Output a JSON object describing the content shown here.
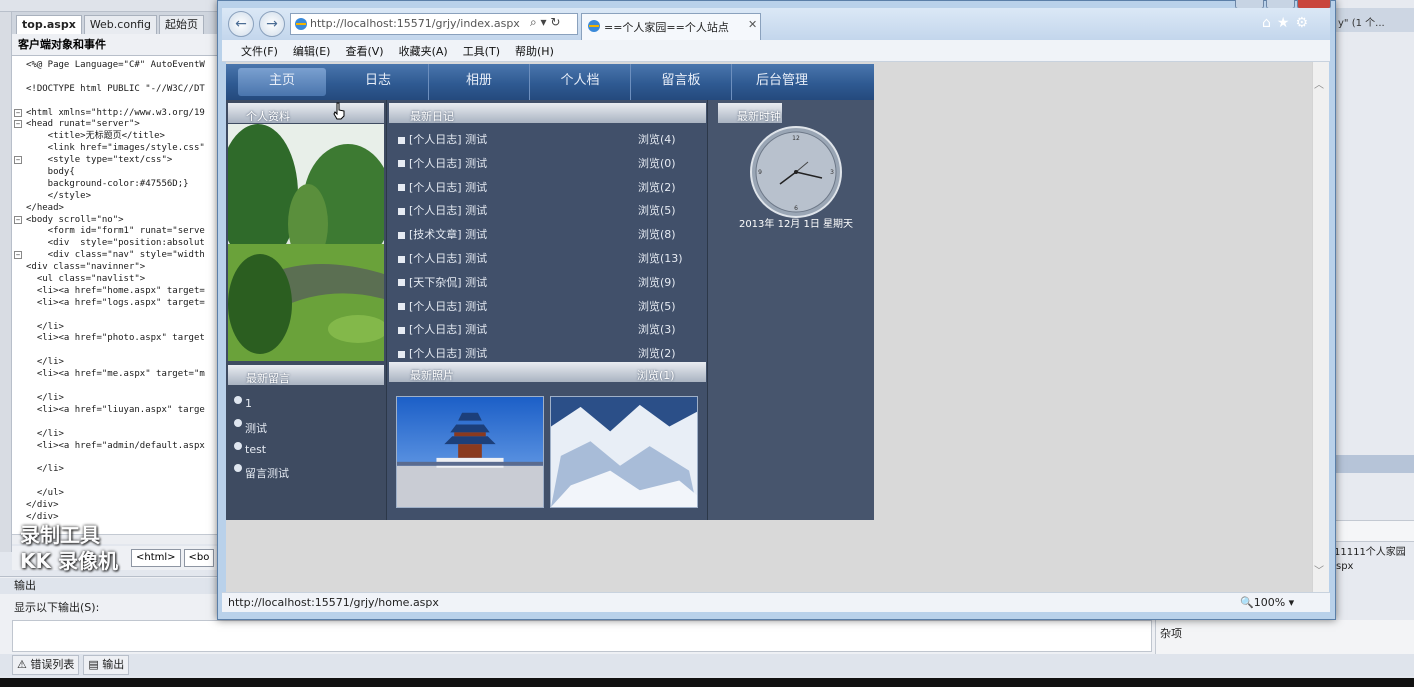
{
  "ide": {
    "tabs": [
      "top.aspx",
      "Web.config",
      "起始页"
    ],
    "object_bar": "客户端对象和事件",
    "code_lines": [
      "<%@ Page Language=\"C#\" AutoEventW",
      "",
      "<!DOCTYPE html PUBLIC \"-//W3C//DT",
      "",
      "<html xmlns=\"http://www.w3.org/19",
      "<head runat=\"server\">",
      "    <title>无标题页</title>",
      "    <link href=\"images/style.css\"",
      "    <style type=\"text/css\">",
      "    body{",
      "    background-color:#47556D;}",
      "    </style>",
      "</head>",
      "<body scroll=\"no\">",
      "    <form id=\"form1\" runat=\"serve",
      "    <div  style=\"position:absolut",
      "    <div class=\"nav\" style=\"width",
      "<div class=\"navinner\">",
      "  <ul class=\"navlist\">",
      "  <li><a href=\"home.aspx\" target=",
      "  <li><a href=\"logs.aspx\" target=",
      "",
      "  </li>",
      "  <li><a href=\"photo.aspx\" target",
      "",
      "  </li>",
      "  <li><a href=\"me.aspx\" target=\"m",
      "",
      "  </li>",
      "  <li><a href=\"liuyan.aspx\" targe",
      "",
      "  </li>",
      "  <li><a href=\"admin/default.aspx",
      "",
      "  </li>",
      "",
      "  </ul>",
      "</div>",
      "</div>"
    ],
    "breadcrumbs": [
      "<html>",
      "<bo"
    ],
    "watermark_line1": "录制工具",
    "watermark_line2": "KK 录像机",
    "output_title": "输出",
    "output_label": "显示以下输出(S):",
    "bottom_tabs": [
      "错误列表",
      "输出"
    ],
    "misc_label": "杂项",
    "right_text_top": "y\" (1 个...",
    "right_text_mid": "11111个人家园",
    "right_text_low": "spx"
  },
  "browser": {
    "address": "http://localhost:15571/grjy/index.aspx",
    "address_tools": "⌕ ▾ ↻",
    "tab_title": "==个人家园==个人站点",
    "tab_close": "✕",
    "menus": [
      "文件(F)",
      "编辑(E)",
      "查看(V)",
      "收藏夹(A)",
      "工具(T)",
      "帮助(H)"
    ],
    "status_url": "http://localhost:15571/grjy/home.aspx",
    "zoom": "🔍100%  ▾",
    "right_icons": "⌂★⚙"
  },
  "site": {
    "nav": [
      "主页",
      "日志",
      "相册",
      "个人档",
      "留言板",
      "后台管理"
    ],
    "headers": {
      "profile": "个人资料",
      "diary": "最新日记",
      "clock": "最新时钟",
      "messages": "最新留言",
      "photos": "最新照片"
    },
    "diary": [
      {
        "title": "[个人日志] 测试",
        "views": "浏览(4)"
      },
      {
        "title": "[个人日志] 测试",
        "views": "浏览(0)"
      },
      {
        "title": "[个人日志] 测试",
        "views": "浏览(2)"
      },
      {
        "title": "[个人日志] 测试",
        "views": "浏览(5)"
      },
      {
        "title": "[技术文章] 测试",
        "views": "浏览(8)"
      },
      {
        "title": "[个人日志] 测试",
        "views": "浏览(13)"
      },
      {
        "title": "[天下杂侃] 测试",
        "views": "浏览(9)"
      },
      {
        "title": "[个人日志] 测试",
        "views": "浏览(5)"
      },
      {
        "title": "[个人日志] 测试",
        "views": "浏览(3)"
      },
      {
        "title": "[个人日志] 测试",
        "views": "浏览(2)"
      }
    ],
    "diary_overflow_views": "浏览(1)",
    "messages": [
      "1",
      "测试",
      "test",
      "留言测试"
    ],
    "clock_date": "2013年 12月 1日 星期天"
  }
}
